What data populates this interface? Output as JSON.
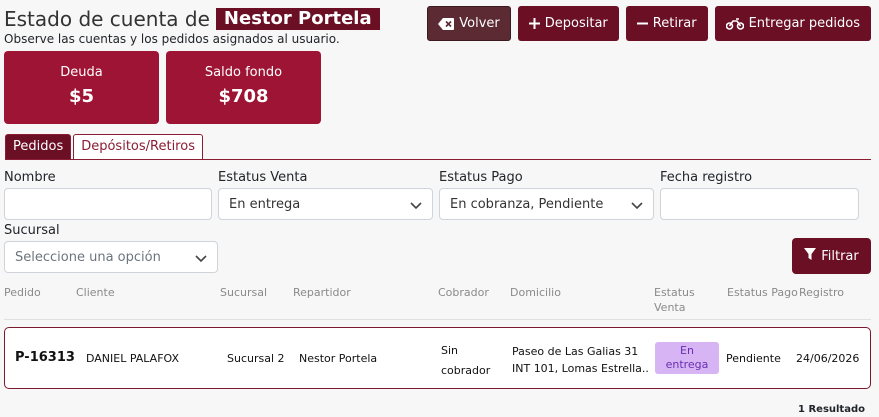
{
  "header": {
    "title_prefix": "Estado de cuenta de",
    "user_name": "Nestor Portela",
    "subtitle": "Observe las cuentas y los pedidos asignados al usuario."
  },
  "actions": {
    "back": "Volver",
    "deposit": "Depositar",
    "withdraw": "Retirar",
    "deliver": "Entregar pedidos"
  },
  "cards": [
    {
      "label": "Deuda",
      "value": "$5"
    },
    {
      "label": "Saldo fondo",
      "value": "$708"
    }
  ],
  "tabs": [
    {
      "label": "Pedidos",
      "active": true
    },
    {
      "label": "Depósitos/Retiros",
      "active": false
    }
  ],
  "filters": {
    "nombre": {
      "label": "Nombre",
      "value": ""
    },
    "estatus_venta": {
      "label": "Estatus Venta",
      "value": "En entrega"
    },
    "estatus_pago": {
      "label": "Estatus Pago",
      "value": "En cobranza, Pendiente"
    },
    "fecha_registro": {
      "label": "Fecha registro",
      "value": ""
    },
    "sucursal": {
      "label": "Sucursal",
      "placeholder": "Seleccione una opción"
    },
    "filter_button": "Filtrar"
  },
  "table": {
    "columns": {
      "pedido": "Pedido",
      "cliente": "Cliente",
      "sucursal": "Sucursal",
      "repartidor": "Repartidor",
      "cobrador": "Cobrador",
      "domicilio": "Domicilio",
      "estatus_venta_1": "Estatus",
      "estatus_venta_2": "Venta",
      "estatus_pago": "Estatus Pago",
      "registro": "Registro"
    },
    "rows": [
      {
        "pedido": "P-16313",
        "cliente": "DANIEL PALAFOX",
        "sucursal": "Sucursal 2",
        "repartidor": "Nestor Portela",
        "cobrador_1": "Sin",
        "cobrador_2": "cobrador",
        "domicilio_1": "Paseo de Las Galias 31",
        "domicilio_2": "INT 101, Lomas Estrella...",
        "estatus_venta_1": "En",
        "estatus_venta_2": "entrega",
        "estatus_pago": "Pendiente",
        "registro": "24/06/2026"
      }
    ],
    "result_count": "1 Resultado"
  },
  "colors": {
    "brand": "#6a0f24",
    "card": "#9e1434",
    "badge_bg": "#d7b4f3",
    "badge_text": "#6a2fb3"
  }
}
